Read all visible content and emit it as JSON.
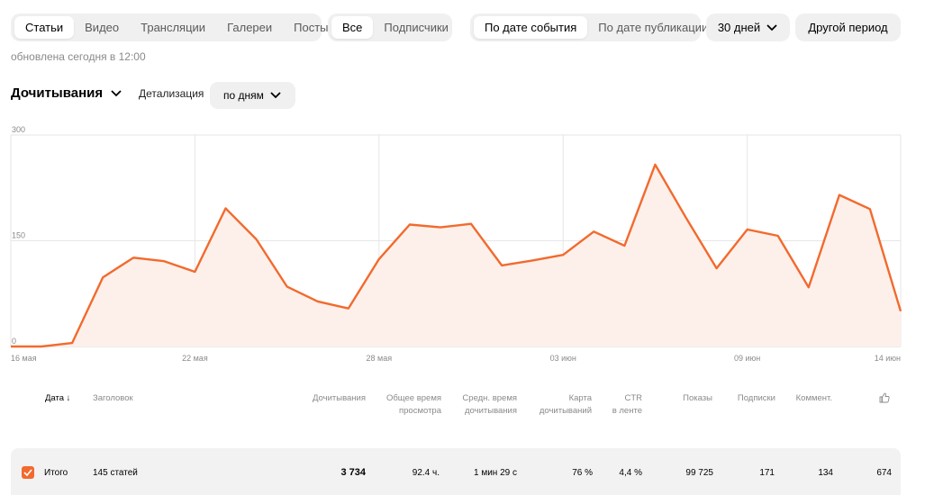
{
  "content_tabs": [
    {
      "label": "Статьи",
      "active": true
    },
    {
      "label": "Видео",
      "active": false
    },
    {
      "label": "Трансляции",
      "active": false
    },
    {
      "label": "Галереи",
      "active": false
    },
    {
      "label": "Посты",
      "active": false
    }
  ],
  "audience_tabs": [
    {
      "label": "Все",
      "active": true
    },
    {
      "label": "Подписчики",
      "active": false
    }
  ],
  "date_mode_tabs": [
    {
      "label": "По дате события",
      "active": true
    },
    {
      "label": "По дате публикации",
      "active": false
    }
  ],
  "period_dropdown": {
    "value": "30 дней"
  },
  "other_period_label": "Другой период",
  "updated_text": "обновлена сегодня в 12:00",
  "metric_selector": {
    "value": "Дочитывания"
  },
  "detail": {
    "label": "Детализация",
    "value": "по дням"
  },
  "colors": {
    "accent": "#f26a2e",
    "fill": "#fdf0ea",
    "tab_bg": "#f0f0f0",
    "row_bg": "#f2f2f2"
  },
  "chart_data": {
    "type": "area",
    "ylim": [
      0,
      300
    ],
    "y_ticks": [
      "0",
      "150",
      "300"
    ],
    "x_tick_labels": [
      {
        "label": "16 мая",
        "x": "2024-05-16"
      },
      {
        "label": "22 мая",
        "x": "2024-05-22"
      },
      {
        "label": "28 мая",
        "x": "2024-05-28"
      },
      {
        "label": "03 июн",
        "x": "2024-06-03"
      },
      {
        "label": "09 июн",
        "x": "2024-06-09"
      },
      {
        "label": "14 июн",
        "x": "2024-06-14"
      }
    ],
    "x": [
      "2024-05-16",
      "2024-05-17",
      "2024-05-18",
      "2024-05-19",
      "2024-05-20",
      "2024-05-21",
      "2024-05-22",
      "2024-05-23",
      "2024-05-24",
      "2024-05-25",
      "2024-05-26",
      "2024-05-27",
      "2024-05-28",
      "2024-05-29",
      "2024-05-30",
      "2024-05-31",
      "2024-06-01",
      "2024-06-02",
      "2024-06-03",
      "2024-06-04",
      "2024-06-05",
      "2024-06-06",
      "2024-06-07",
      "2024-06-08",
      "2024-06-09",
      "2024-06-10",
      "2024-06-11",
      "2024-06-12",
      "2024-06-13",
      "2024-06-14"
    ],
    "series": [
      {
        "values": [
          0,
          0,
          5,
          98,
          126,
          121,
          106,
          196,
          152,
          85,
          64,
          54,
          124,
          173,
          169,
          174,
          115,
          122,
          130,
          163,
          143,
          258,
          183,
          111,
          166,
          157,
          84,
          215,
          195,
          50
        ]
      }
    ]
  },
  "table": {
    "headers": {
      "date": "Дата ↓",
      "title": "Заголовок",
      "reads": "Дочитывания",
      "total_time_1": "Общее время",
      "total_time_2": "просмотра",
      "avg_time_1": "Средн. время",
      "avg_time_2": "дочитывания",
      "map_1": "Карта",
      "map_2": "дочитываний",
      "ctr_1": "CTR",
      "ctr_2": "в ленте",
      "impressions": "Показы",
      "subscriptions": "Подписки",
      "comments": "Коммент.",
      "likes_icon": "thumbs-up-icon"
    },
    "total": {
      "label": "Итого",
      "title": "145 статей",
      "reads": "3 734",
      "total_time": "92.4 ч.",
      "avg_time": "1 мин 29 с",
      "map": "76 %",
      "ctr": "4,4 %",
      "impressions": "99 725",
      "subscriptions": "171",
      "comments": "134",
      "likes": "674"
    }
  }
}
